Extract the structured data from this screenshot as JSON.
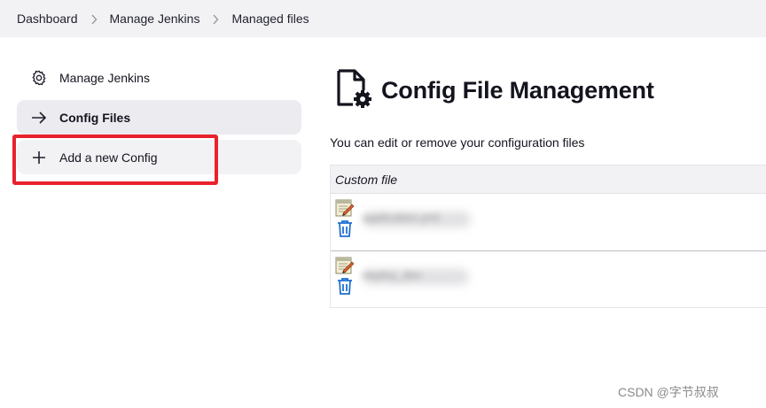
{
  "breadcrumb": {
    "items": [
      "Dashboard",
      "Manage Jenkins",
      "Managed files"
    ]
  },
  "sidebar": {
    "items": [
      {
        "label": "Manage Jenkins",
        "icon": "gear-icon"
      },
      {
        "label": "Config Files",
        "icon": "arrow-right-icon",
        "active": true
      },
      {
        "label": "Add a new Config",
        "icon": "plus-icon"
      }
    ],
    "highlight_color": "#e8222c"
  },
  "main": {
    "title": "Config File Management",
    "description": "You can edit or remove your configuration files",
    "table": {
      "header": "Custom file",
      "rows": [
        {
          "name": "application.yml"
        },
        {
          "name": "deploy_dev"
        }
      ]
    }
  },
  "watermark": "CSDN @字节叔叔"
}
